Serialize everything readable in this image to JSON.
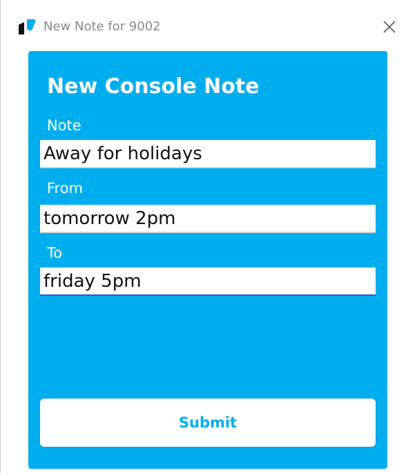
{
  "window": {
    "title": "New Note for 9002",
    "icon": "phone-handset-icon",
    "close_icon": "close-icon"
  },
  "form": {
    "heading": "New Console Note",
    "fields": [
      {
        "label": "Note",
        "value": "Away for holidays"
      },
      {
        "label": "From",
        "value": "tomorrow 2pm"
      },
      {
        "label": "To",
        "value": "friday 5pm"
      }
    ],
    "submit_label": "Submit"
  },
  "colors": {
    "panel": "#00aeef",
    "accent_text": "#00aeef",
    "active_underline": "#3b4fd8"
  }
}
